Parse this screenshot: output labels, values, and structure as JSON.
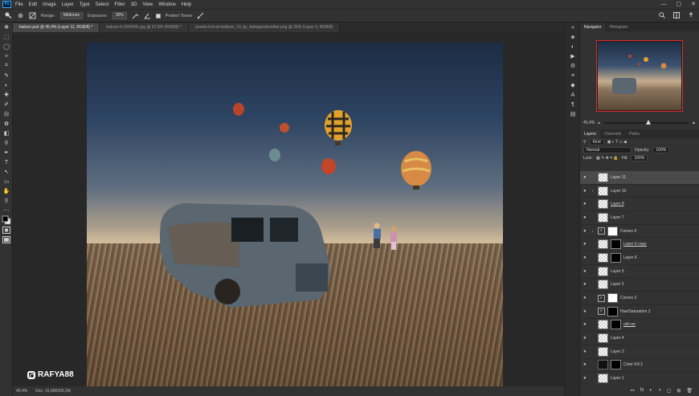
{
  "app": {
    "logo": "Ps"
  },
  "menu": [
    "File",
    "Edit",
    "Image",
    "Layer",
    "Type",
    "Select",
    "Filter",
    "3D",
    "View",
    "Window",
    "Help"
  ],
  "window_controls": [
    "—",
    "▢",
    "✕"
  ],
  "options": {
    "range_label": "Range:",
    "range_value": "Midtones",
    "exposure_label": "Exposure:",
    "exposure_value": "30%",
    "protect_tones": "Protect Tones"
  },
  "tabs": [
    "baloon.psd @ 45,4% (Layer 11, RGB/8) *",
    "baloon-6-1592041.jpg @ 97,6% (RGB/8) *",
    "pexels-hot-air-balloon_13_by_fairiegoodmother.png @ 25% (Layer 0, RGB/8)"
  ],
  "status": {
    "zoom": "45,4%",
    "doc": "Doc: 15,0M/205,2M"
  },
  "watermark": "RAFYA88",
  "panels": {
    "nav_tabs": [
      "Navigator",
      "Histogram"
    ],
    "nav_zoom": "45,4%",
    "layer_tabs": [
      "Layers",
      "Channels",
      "Paths"
    ],
    "filter_label": "Kind",
    "blend_mode": "Normal",
    "opacity_label": "Opacity:",
    "opacity_value": "100%",
    "lock_label": "Lock:",
    "fill_label": "Fill:",
    "fill_value": "100%"
  },
  "layers": [
    {
      "name": "Layer 11",
      "thumb": "checker",
      "selected": true
    },
    {
      "name": "Layer 10",
      "thumb": "checker",
      "clipped": true
    },
    {
      "name": "Layer 8",
      "thumb": "checker",
      "underline": true
    },
    {
      "name": "Layer 7",
      "thumb": "checker"
    },
    {
      "name": "Curves 4",
      "thumb": "adj",
      "mask": "white",
      "clipped": true
    },
    {
      "name": "Layer 6 copy",
      "thumb": "checker",
      "mask": "dark",
      "underline": true
    },
    {
      "name": "Layer 6",
      "thumb": "checker",
      "mask": "dark"
    },
    {
      "name": "Layer 5",
      "thumb": "checker"
    },
    {
      "name": "Layer 2",
      "thumb": "checker"
    },
    {
      "name": "Curves 3",
      "thumb": "adj",
      "mask": "white"
    },
    {
      "name": "Hue/Saturation 2",
      "thumb": "adj",
      "mask": "dark"
    },
    {
      "name": "old car",
      "thumb": "checker",
      "mask": "dark",
      "underline": true
    },
    {
      "name": "Layer 4",
      "thumb": "checker"
    },
    {
      "name": "Layer 3",
      "thumb": "checker"
    },
    {
      "name": "Color Fill 2",
      "thumb": "dark",
      "mask": "dark"
    },
    {
      "name": "Layer 1",
      "thumb": "checker"
    }
  ],
  "tools": [
    "✥",
    "⬚",
    "◯",
    "✧",
    "⌗",
    "✎",
    "◐",
    "✚",
    "✐",
    "⊟",
    "✿",
    "◧",
    "⚲",
    "✒",
    "T",
    "↖",
    "▭",
    "✋",
    "⚲",
    "⋯"
  ],
  "dock_icons": [
    "◈",
    "◐",
    "▶",
    "⚙",
    "≡",
    "◆",
    "A",
    "¶",
    "▤"
  ],
  "footer_icons": [
    "fx",
    "◐",
    "◑",
    "▢",
    "⊞",
    "🗑"
  ]
}
